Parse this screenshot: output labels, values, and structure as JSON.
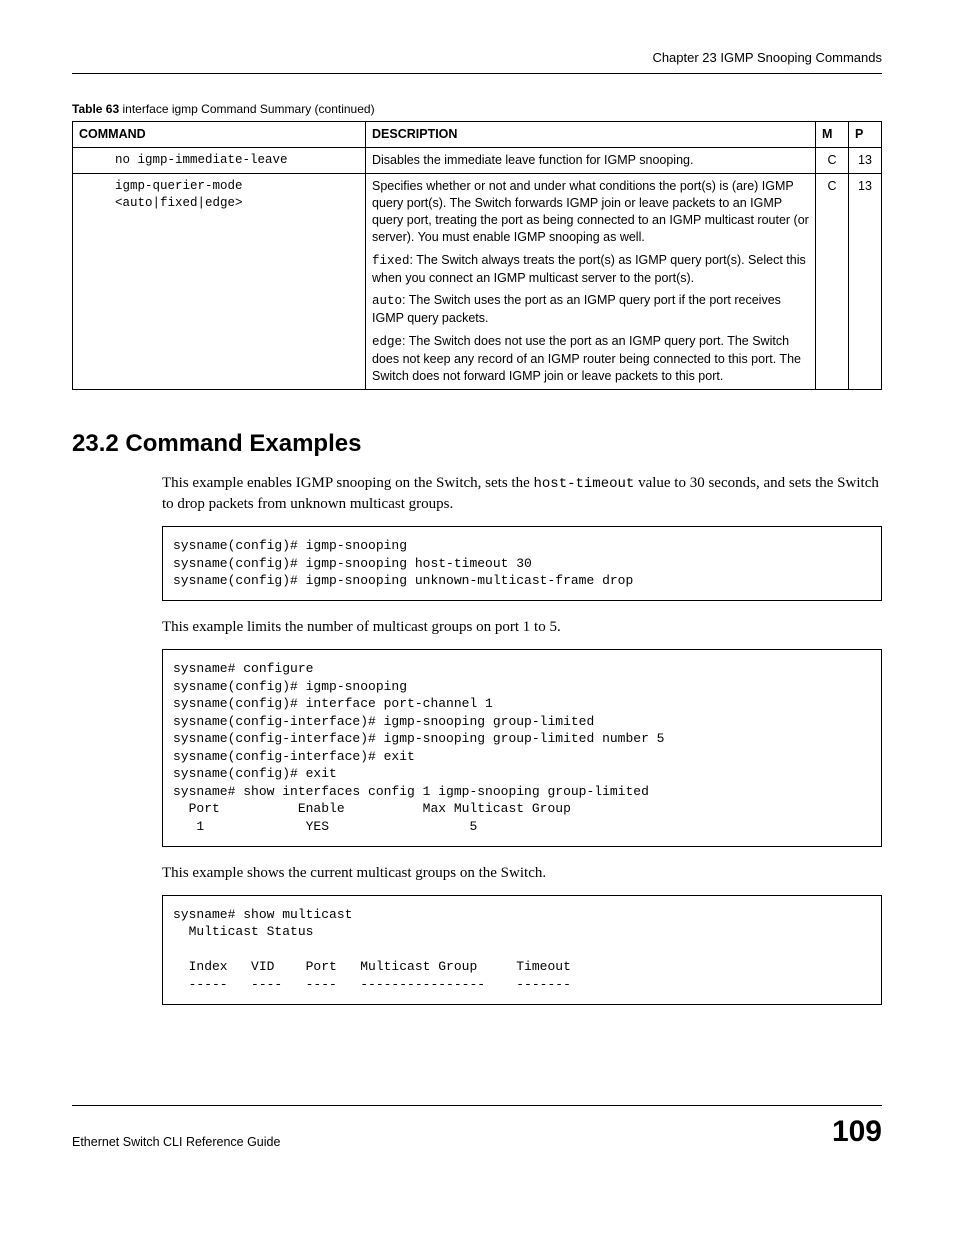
{
  "chapter_header": "Chapter 23 IGMP Snooping Commands",
  "table": {
    "caption_bold": "Table 63",
    "caption_rest": "   interface igmp Command Summary (continued)",
    "headers": {
      "command": "COMMAND",
      "description": "DESCRIPTION",
      "m": "M",
      "p": "P"
    },
    "rows": [
      {
        "command": "no igmp-immediate-leave",
        "description": "Disables the immediate leave function for IGMP snooping.",
        "m": "C",
        "p": "13"
      },
      {
        "command_line1": "igmp-querier-mode",
        "command_line2": "<auto|fixed|edge>",
        "desc1": "Specifies whether or not and under what conditions the port(s) is (are) IGMP query port(s). The Switch forwards IGMP join or leave packets to an IGMP query port, treating the port as being connected to an IGMP multicast router (or server). You must enable IGMP snooping as well.",
        "desc2_code": "fixed",
        "desc2_rest": ": The Switch always treats the port(s) as IGMP query port(s). Select this when you connect an IGMP multicast server to the port(s).",
        "desc3_code": "auto",
        "desc3_rest": ": The Switch uses the port as an IGMP query port if the port receives IGMP query packets.",
        "desc4_code": "edge",
        "desc4_rest": ": The Switch does not use the port as an IGMP query port. The Switch does not keep any record of an IGMP router being connected to this port. The Switch does not forward IGMP join or leave packets to this port.",
        "m": "C",
        "p": "13"
      }
    ]
  },
  "section": {
    "title": "23.2  Command Examples",
    "para1_a": "This example enables IGMP snooping on the Switch, sets the ",
    "para1_code": "host-timeout",
    "para1_b": " value to 30 seconds, and sets the Switch to drop packets from unknown multicast groups.",
    "code1": "sysname(config)# igmp-snooping\nsysname(config)# igmp-snooping host-timeout 30\nsysname(config)# igmp-snooping unknown-multicast-frame drop",
    "para2": "This example limits the number of multicast groups on port 1 to 5.",
    "code2": "sysname# configure\nsysname(config)# igmp-snooping\nsysname(config)# interface port-channel 1\nsysname(config-interface)# igmp-snooping group-limited\nsysname(config-interface)# igmp-snooping group-limited number 5\nsysname(config-interface)# exit\nsysname(config)# exit\nsysname# show interfaces config 1 igmp-snooping group-limited\n  Port          Enable          Max Multicast Group\n   1             YES                  5",
    "para3": "This example shows the current multicast groups on the Switch.",
    "code3": "sysname# show multicast\n  Multicast Status\n\n  Index   VID    Port   Multicast Group     Timeout\n  -----   ----   ----   ----------------    -------"
  },
  "footer": {
    "left": "Ethernet Switch CLI Reference Guide",
    "right": "109"
  }
}
